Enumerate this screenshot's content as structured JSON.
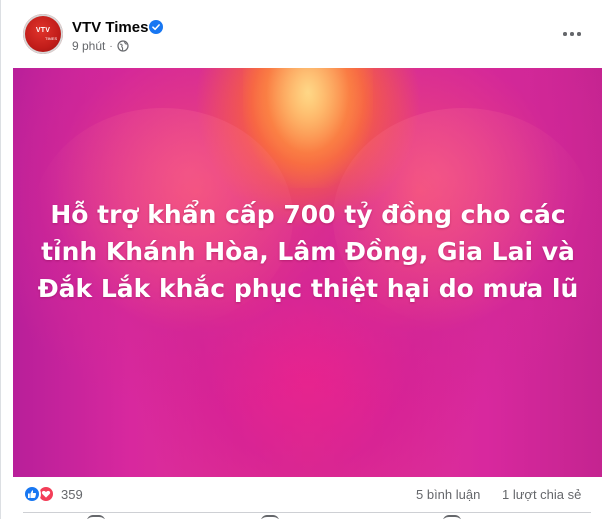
{
  "post": {
    "page_name": "VTV Times",
    "verified": true,
    "time": "9 phút",
    "separator": "·",
    "privacy_icon": "globe-icon",
    "more_icon": "more-options-icon"
  },
  "avatar": {
    "logo_text": "VTV",
    "logo_sub": "TIMES"
  },
  "image": {
    "headline": "Hỗ trợ khẩn cấp 700 tỷ đồng cho các tỉnh Khánh Hòa, Lâm Đồng, Gia Lai và Đắk Lắk khắc phục thiệt hại do mưa lũ",
    "colors": {
      "primary_pink": "#e23a8c",
      "magenta": "#b81f9a",
      "orange_glow": "#ff8c3c"
    }
  },
  "footer": {
    "reaction_icons": [
      "like-icon",
      "love-icon"
    ],
    "reaction_count": "359",
    "comments": "5 bình luận",
    "shares": "1 lượt chia sẻ"
  },
  "colors": {
    "text_primary": "#050505",
    "text_secondary": "#65676b",
    "verified_blue": "#1877f2",
    "love_red": "#f33e58"
  }
}
